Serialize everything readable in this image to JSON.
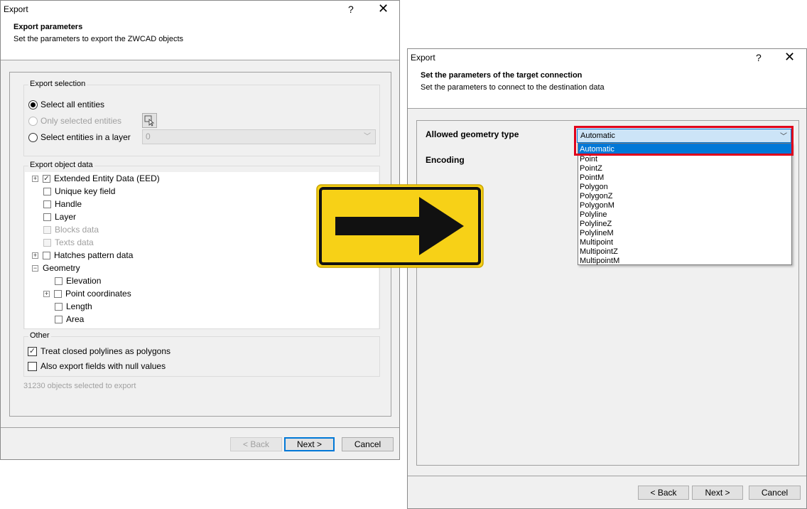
{
  "left_dialog": {
    "title": "Export",
    "help": "?",
    "close": "✕",
    "header_title": "Export parameters",
    "header_subtitle": "Set the parameters to export the ZWCAD objects",
    "export_selection": {
      "label": "Export selection",
      "select_all": "Select all entities",
      "only_selected": "Only selected entities",
      "select_layer": "Select entities in a layer",
      "layer_value": "0"
    },
    "export_object_data": {
      "label": "Export object data",
      "items": [
        "Extended Entity Data (EED)",
        "Unique key field",
        "Handle",
        "Layer",
        "Blocks data",
        "Texts data",
        "Hatches pattern data",
        "Geometry",
        "Elevation",
        "Point coordinates",
        "Length",
        "Area"
      ]
    },
    "other": {
      "label": "Other",
      "treat_closed": "Treat closed polylines as polygons",
      "null_values": "Also export fields with null values"
    },
    "status": "31230 objects selected to export",
    "buttons": {
      "back": "< Back",
      "next": "Next >",
      "cancel": "Cancel"
    }
  },
  "right_dialog": {
    "title": "Export",
    "help": "?",
    "close": "✕",
    "header_title": "Set the parameters of the target connection",
    "header_subtitle": "Set the parameters to connect to the destination data",
    "geometry_label": "Allowed geometry type",
    "geometry_value": "Automatic",
    "encoding_label": "Encoding",
    "geometry_options": [
      "Automatic",
      "Point",
      "PointZ",
      "PointM",
      "Polygon",
      "PolygonZ",
      "PolygonM",
      "Polyline",
      "PolylineZ",
      "PolylineM",
      "Multipoint",
      "MultipointZ",
      "MultipointM"
    ],
    "buttons": {
      "back": "< Back",
      "next": "Next >",
      "cancel": "Cancel"
    }
  },
  "colors": {
    "highlight": "#0078d7",
    "callout": "#e0001b",
    "sign_yellow": "#f7d117"
  },
  "icons": {
    "arrow_sign": "right-arrow-sign-icon",
    "pick": "pick-objects-icon"
  }
}
